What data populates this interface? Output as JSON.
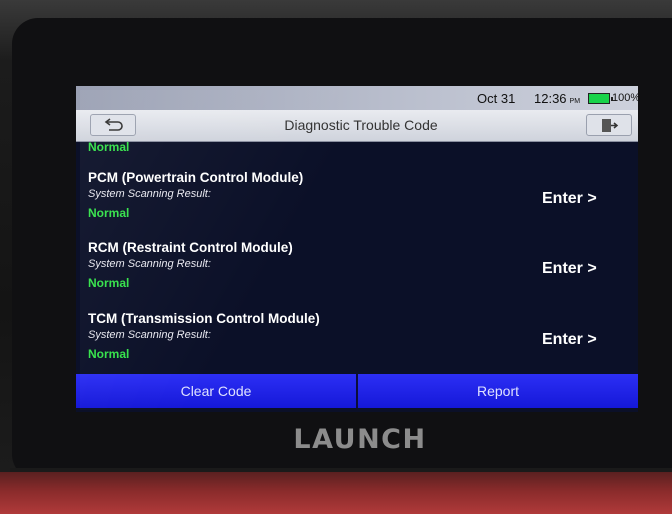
{
  "status_bar": {
    "date": "Oct 31",
    "time": "12:36",
    "ampm": "PM",
    "battery": "100%",
    "battery_color": "#19d34a"
  },
  "title_bar": {
    "title": "Diagnostic Trouble Code",
    "back_icon": "back-arrow-icon",
    "exit_icon": "exit-icon"
  },
  "partial_item": {
    "status": "Normal"
  },
  "modules": [
    {
      "name": "PCM (Powertrain Control Module)",
      "sub": "System Scanning Result:",
      "status": "Normal",
      "enter": "Enter >"
    },
    {
      "name": "RCM (Restraint Control Module)",
      "sub": "System Scanning Result:",
      "status": "Normal",
      "enter": "Enter >"
    },
    {
      "name": "TCM (Transmission Control Module)",
      "sub": "System Scanning Result:",
      "status": "Normal",
      "enter": "Enter >"
    }
  ],
  "actions": {
    "clear_code": "Clear Code",
    "report": "Report"
  },
  "device": {
    "brand": "LAUNCH"
  },
  "colors": {
    "status_normal": "#34e24a",
    "action_blue": "#1f22e8"
  }
}
